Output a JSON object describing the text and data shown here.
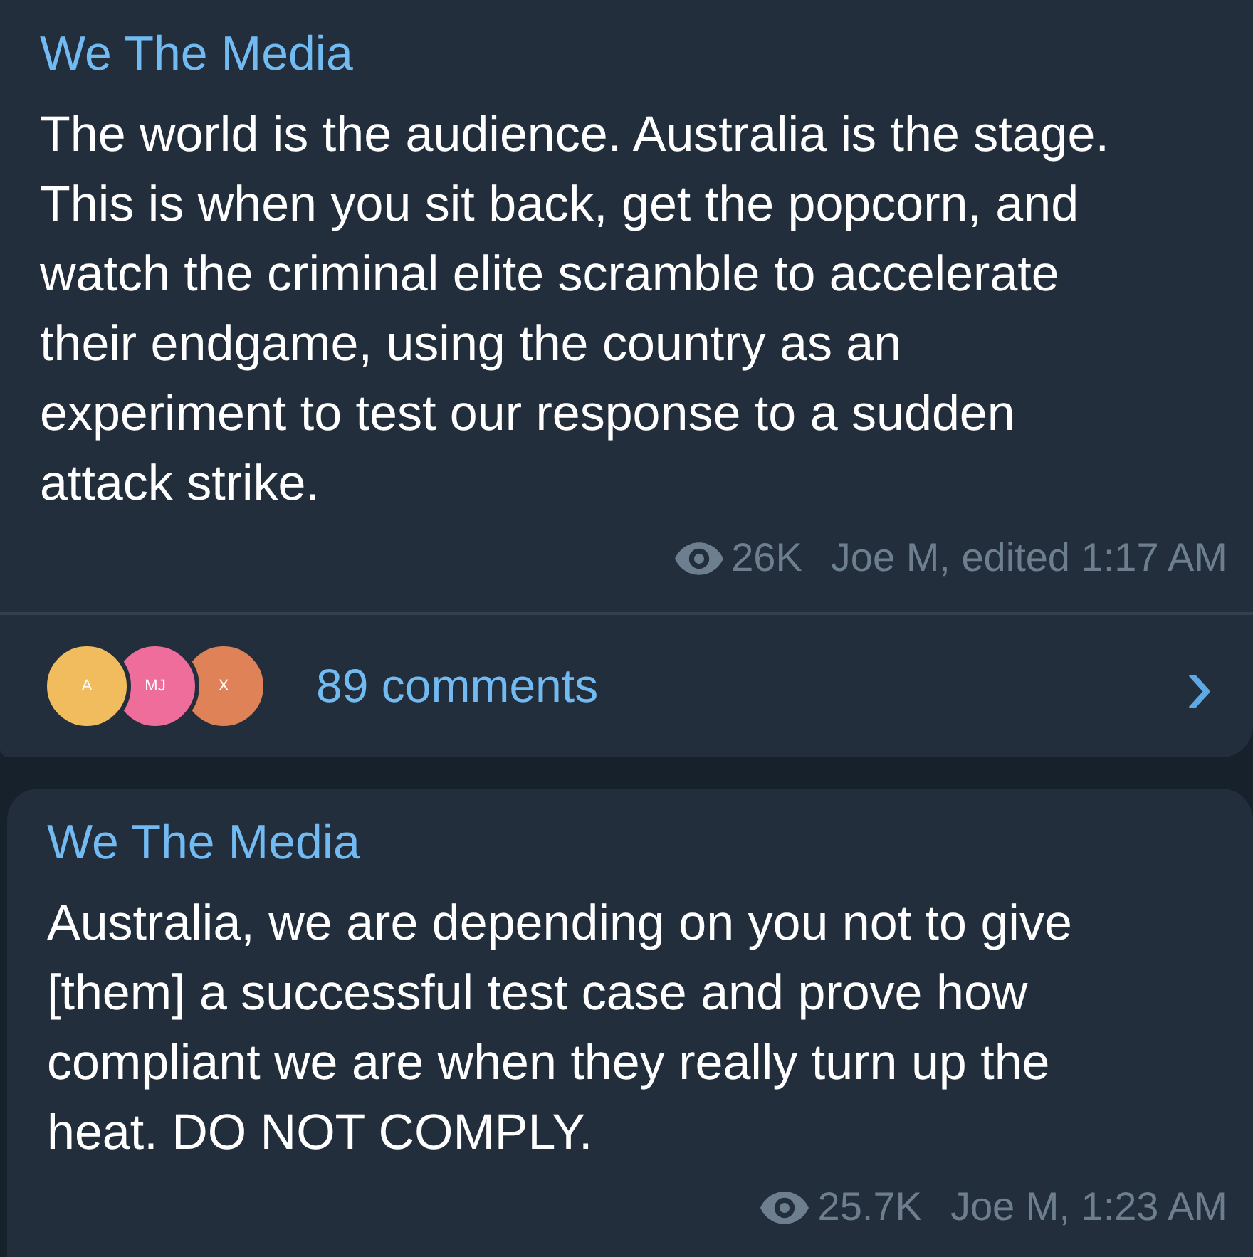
{
  "messages": [
    {
      "channel": "We The Media",
      "text": "The world is the audience. Australia is the stage. This is when you sit back, get the popcorn, and watch the criminal elite scramble to accelerate their endgame, using the country as an experiment to test our response to a sudden attack strike.",
      "views": "26K",
      "signature": "Joe M, edited 1:17 AM",
      "comments": {
        "avatars": [
          {
            "initials": "A",
            "color": "#f0bc5e"
          },
          {
            "initials": "MJ",
            "color": "#ee6d9b"
          },
          {
            "initials": "X",
            "color": "#df8257"
          }
        ],
        "label": "89 comments",
        "chevron": "›"
      }
    },
    {
      "channel": "We The Media",
      "text": "Australia, we are depending on you not to give [them] a successful test case and prove how compliant we are when they really turn up the heat. DO NOT COMPLY.",
      "views": "25.7K",
      "signature": "Joe M, 1:23 AM"
    }
  ]
}
